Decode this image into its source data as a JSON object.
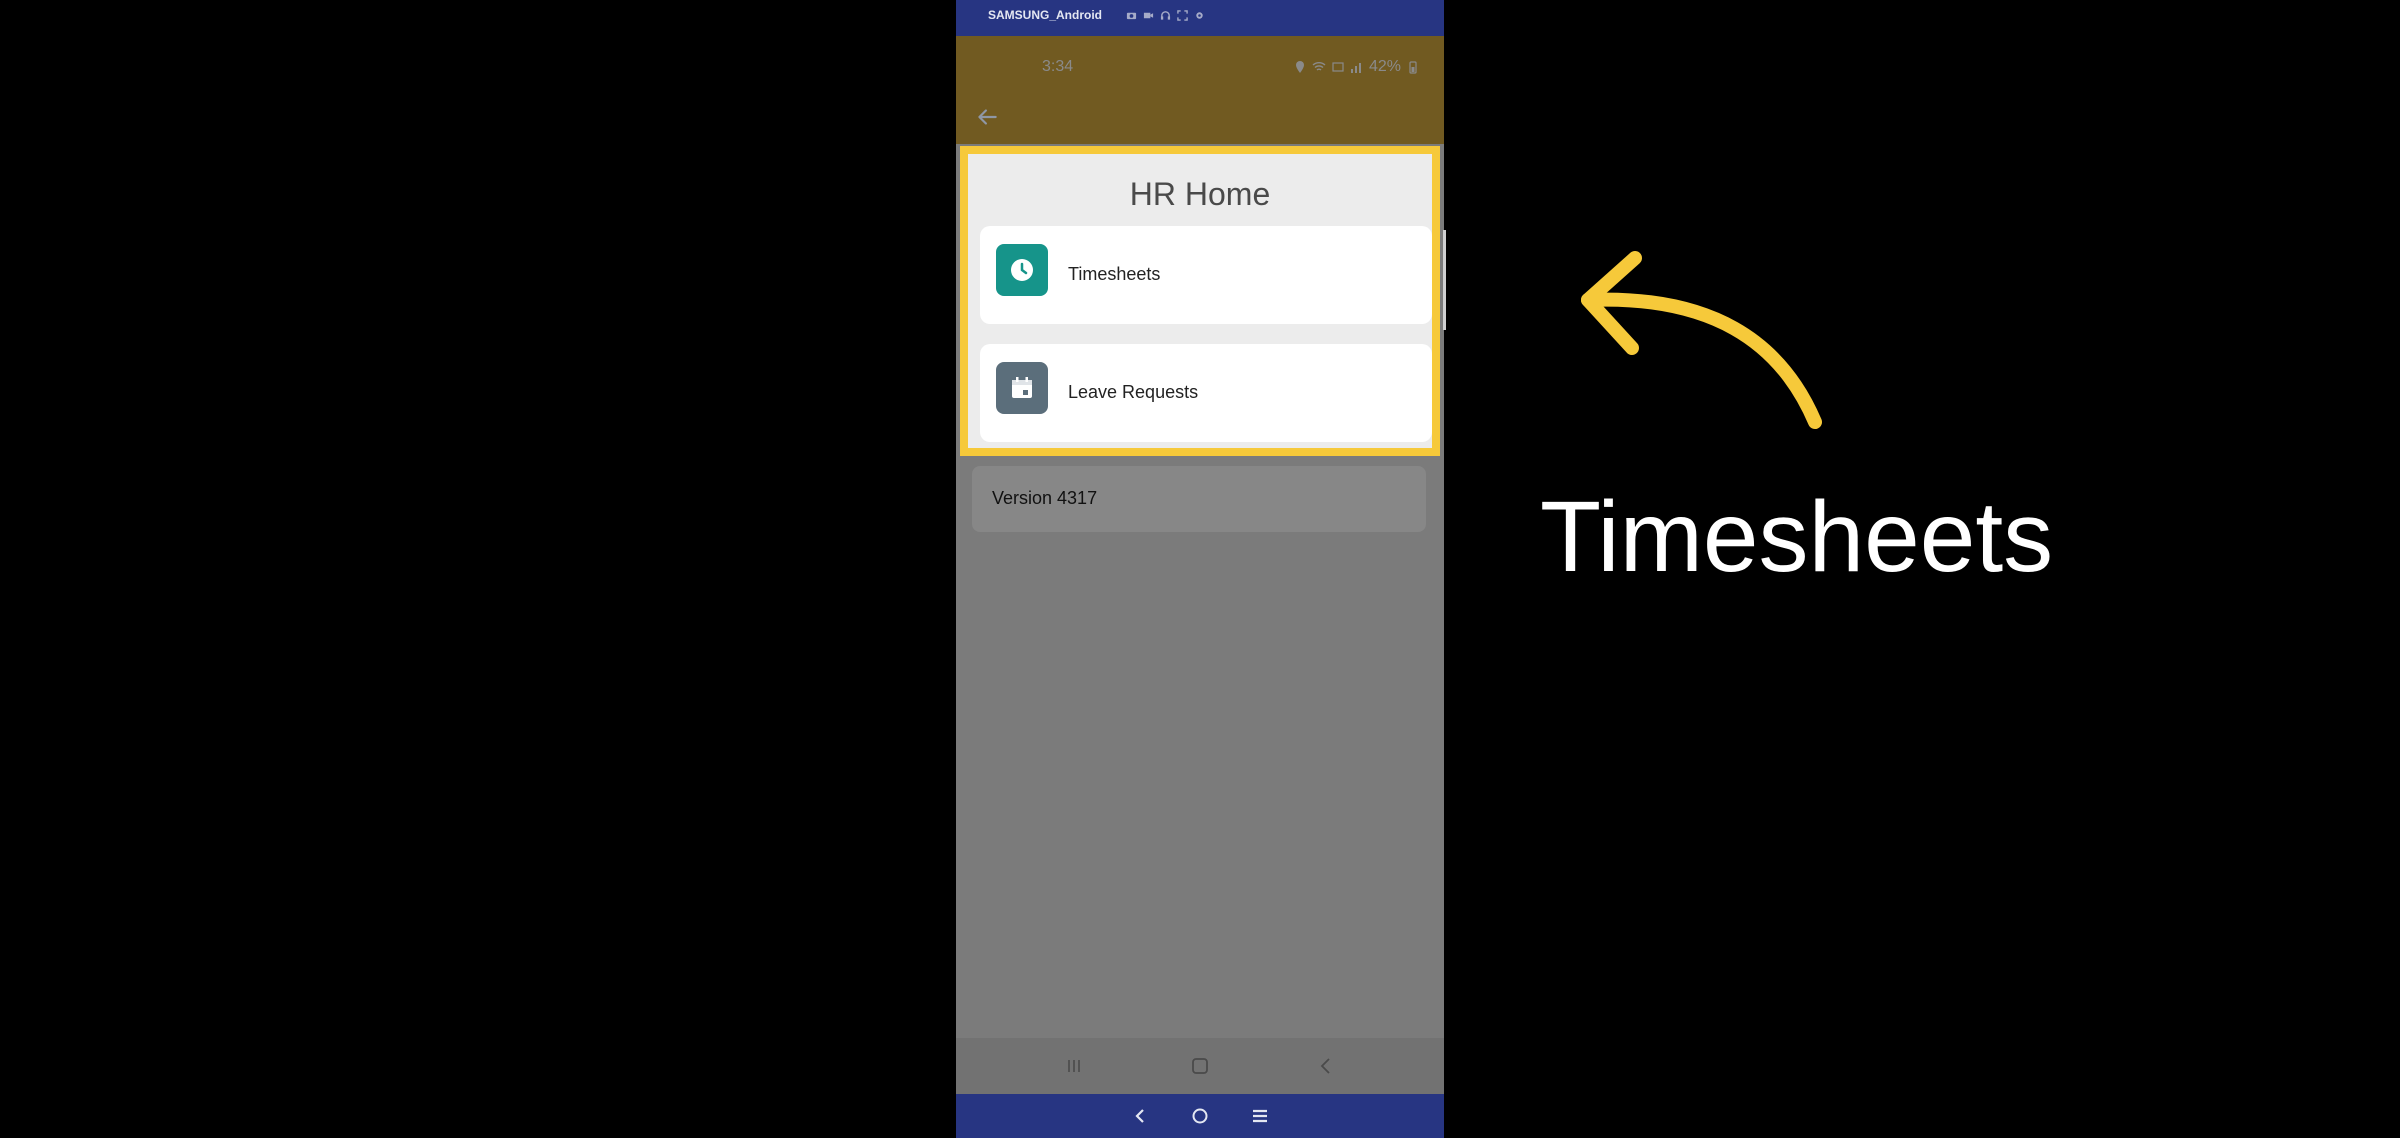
{
  "mirror_bar": {
    "device_name": "SAMSUNG_Android"
  },
  "status_bar": {
    "time": "3:34",
    "battery": "42%"
  },
  "overlay": {
    "title": "HR Home",
    "items": [
      {
        "label": "Timesheets",
        "icon": "clock-icon",
        "color": "#16948a"
      },
      {
        "label": "Leave Requests",
        "icon": "calendar-icon",
        "color": "#5b6e7b"
      }
    ]
  },
  "version": {
    "label": "Version 4317"
  },
  "annotation": {
    "caption": "Timesheets",
    "highlight_color": "#f6c93a"
  }
}
